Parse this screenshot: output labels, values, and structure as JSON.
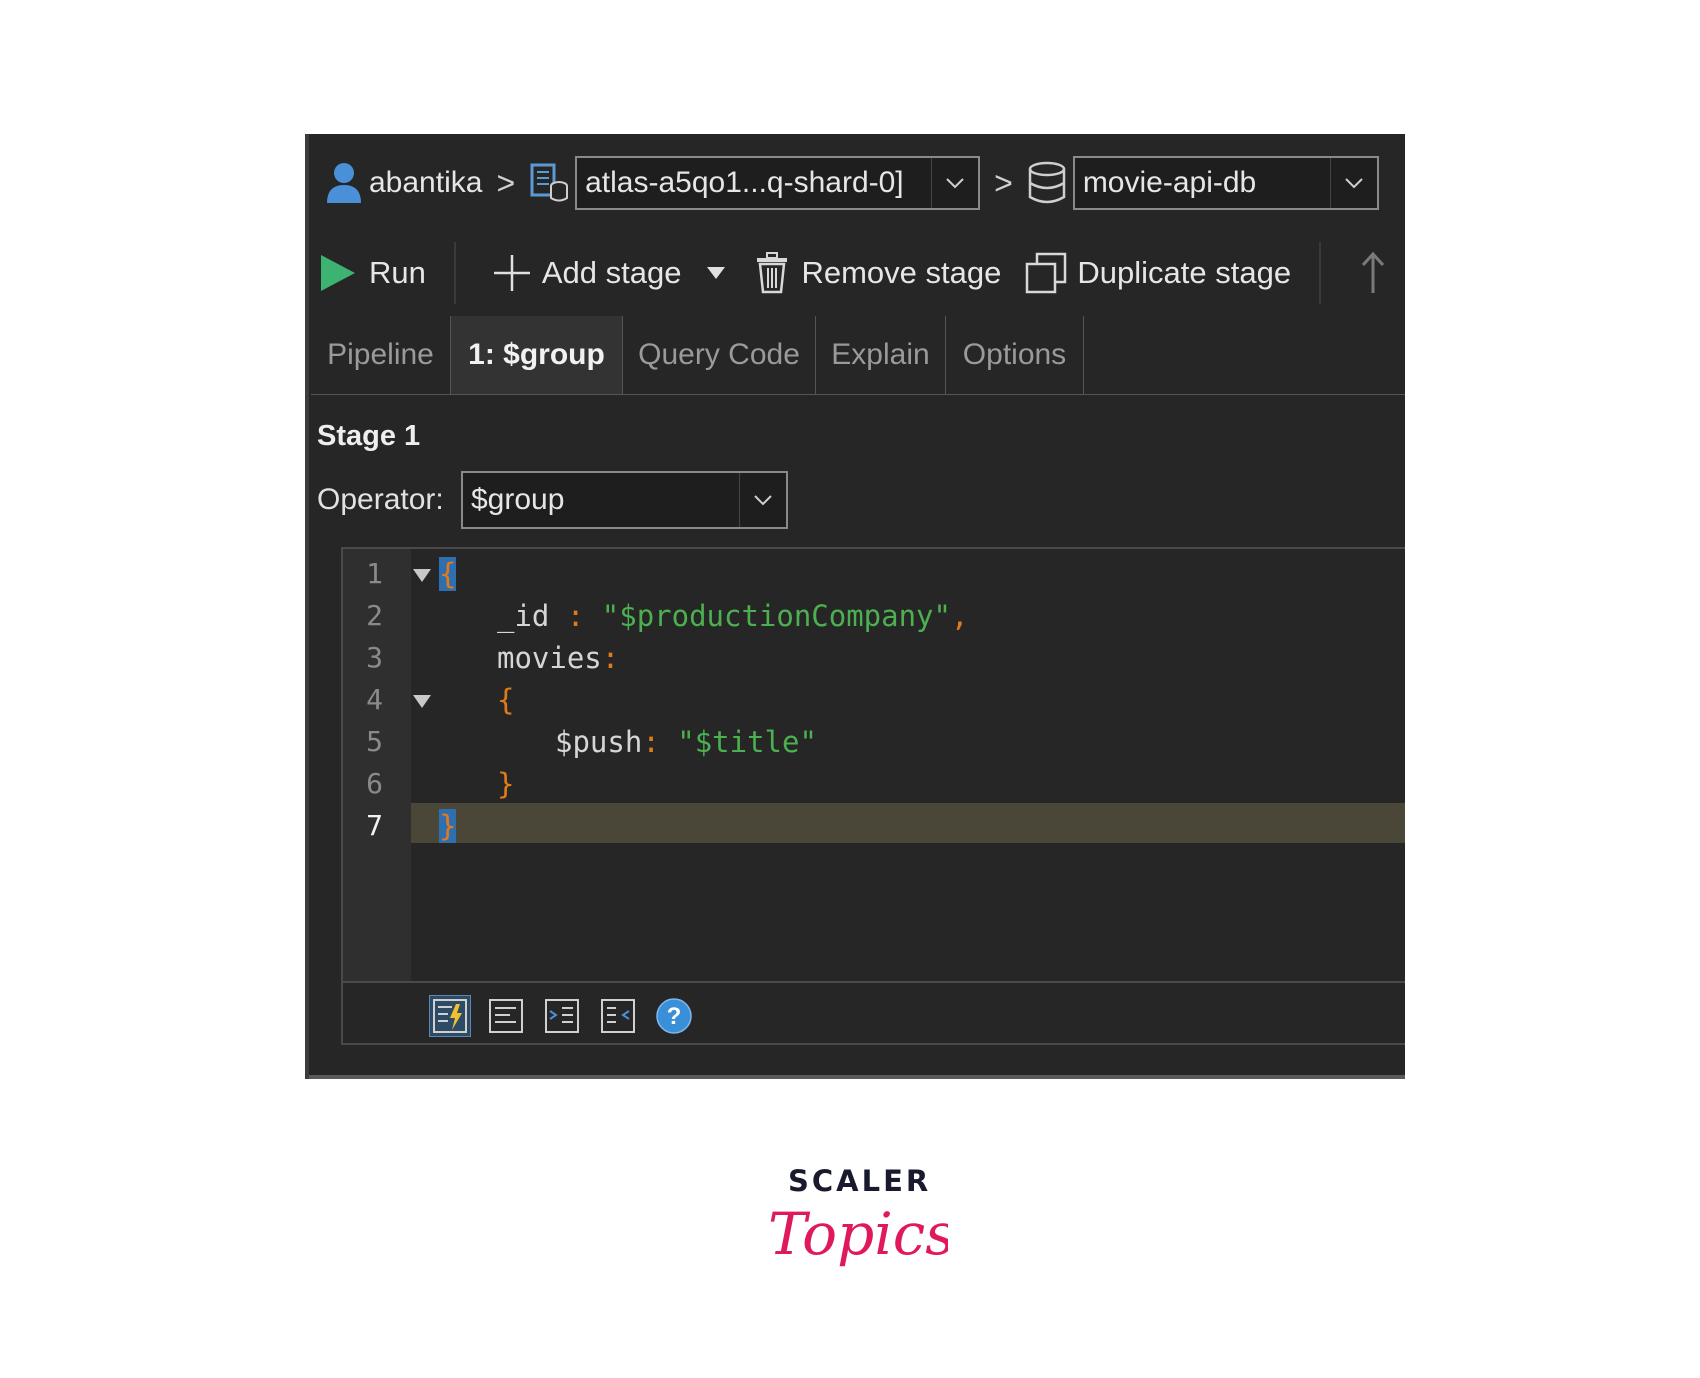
{
  "breadcrumb": {
    "user": "abantika",
    "cluster": "atlas-a5qo1...q-shard-0]",
    "database": "movie-api-db"
  },
  "toolbar": {
    "run": "Run",
    "add_stage": "Add stage",
    "remove_stage": "Remove stage",
    "duplicate_stage": "Duplicate stage"
  },
  "tabs": [
    "Pipeline",
    "1: $group",
    "Query Code",
    "Explain",
    "Options"
  ],
  "active_tab": "1: $group",
  "stage": {
    "title": "Stage 1",
    "operator_label": "Operator:",
    "operator_value": "$group"
  },
  "editor": {
    "line_numbers": [
      "1",
      "2",
      "3",
      "4",
      "5",
      "6",
      "7"
    ],
    "current_line": 7,
    "code": {
      "l1": "{",
      "l2_key": "_id",
      "l2_colon": " : ",
      "l2_value": "\"$productionCompany\"",
      "l2_comma": ",",
      "l3_key": "movies",
      "l3_colon": ":",
      "l4": "{",
      "l5_key": "$push",
      "l5_colon": ": ",
      "l5_value": "\"$title\"",
      "l6": "}",
      "l7": "}"
    }
  },
  "colors": {
    "background": "#262626",
    "punctuation": "#e07a1a",
    "string": "#4caf50",
    "run_icon": "#3cb371",
    "help_icon": "#3a8fd9",
    "logo_dark": "#1a1a2e",
    "logo_pink": "#e0195f"
  },
  "logo": {
    "top": "SCALER",
    "script": "Topics"
  }
}
